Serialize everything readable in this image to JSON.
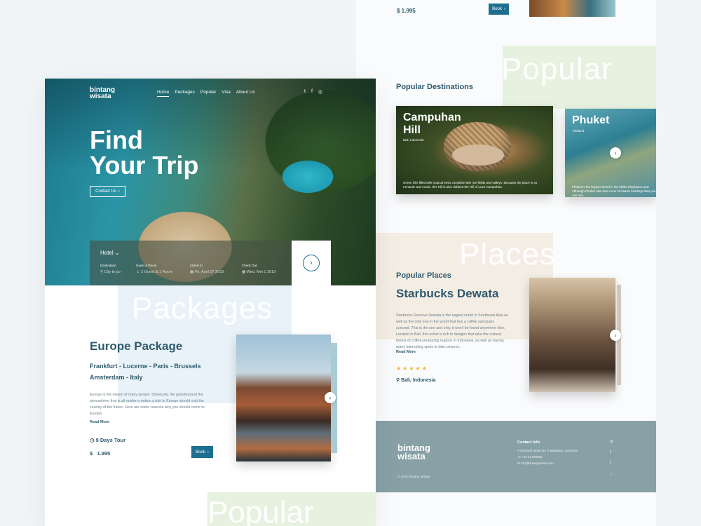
{
  "brand": {
    "logo_line1": "bintang",
    "logo_line2": "wisata",
    "accent_color": "#e2454a",
    "primary_color": "#1e6f8f"
  },
  "top_strip": {
    "price": "$  1.995",
    "book_label": "Book",
    "arrow": "›"
  },
  "nav": {
    "items": [
      {
        "label": "Home",
        "active": true
      },
      {
        "label": "Packages",
        "active": false
      },
      {
        "label": "Popular",
        "active": false
      },
      {
        "label": "Visa",
        "active": false
      },
      {
        "label": "About Us",
        "active": false
      }
    ],
    "social_icons": [
      "twitter-icon",
      "facebook-icon",
      "instagram-icon"
    ],
    "social_glyphs": [
      "t",
      "f",
      "◎"
    ]
  },
  "hero": {
    "title_line1": "Find",
    "title_line2": "Your Trip",
    "cta_label": "Contact Us",
    "cta_arrow": "›"
  },
  "search": {
    "type": "Hotel",
    "type_arrow": "⌄",
    "fields": [
      {
        "label": "Destination",
        "value": "City to go",
        "icon": "location-pin-icon"
      },
      {
        "label": "Guest & Room",
        "value": "2 Guest & 1 Room",
        "icon": "person-icon"
      },
      {
        "label": "Check In",
        "value": "Fri, April 27 2019",
        "icon": "calendar-icon"
      },
      {
        "label": "Check Out",
        "value": "Wed, Mei 1 2019",
        "icon": "calendar-icon"
      }
    ],
    "go_arrow": "›"
  },
  "packages": {
    "bg_word": "Packages",
    "title": "Europe Package",
    "route_line1": "Frankfurt - Lucerne - Paris - Brussels",
    "route_line2": "Amsterdam  - Italy",
    "description": "Europe is the dream of many people. Obviously, the grandeurand the atmosphere that is all modern makes a visit to Europe should visit the country of the future. Here are some reasons why you should come to Europe.",
    "read_more": "Read More",
    "duration": "9 Days Tour",
    "price": "1.995",
    "currency": "$",
    "book_label": "Book",
    "arrow": "›"
  },
  "popular_destinations": {
    "bg_word": "Popular",
    "title": "Popular Destinations",
    "cards": [
      {
        "name_line1": "Campuhan",
        "name_line2": "Hill",
        "location": "Bali, Indonesia",
        "description": "Green hills filled with tropical trees complete with rice fields and valleys. Because the place is so romantic and exotic, this Hill is also dubbed the Hill of Love Campuhan."
      },
      {
        "name_line1": "Phuket",
        "name_line2": "",
        "location": "Thailand",
        "description": "Phuket is the largest island in the White Elephant Land. Although Phuket also has a row of classic buildings that you can see."
      }
    ],
    "next_arrow": "›"
  },
  "popular_places": {
    "bg_word": "Places",
    "title": "Popular Places",
    "place_name": "Starbucks Dewata",
    "description": "Starbucks Reserve Dewata is the largest outlet in Southeast Asia as well as the only one in the world that has a coffee sanctuary concept. This is the one and only, it won't be found anywhere else. Located in Bali, this outlet is rich in designs that take the cultural theme of coffee-producing regions in Indonesia, as well as having many interesting spots to take pictures.",
    "read_more": "Read More",
    "rating": 5,
    "stars": "★★★★★",
    "location": "Bali, Indonesia",
    "next_arrow": "›"
  },
  "footer": {
    "copyright": "© 2020 Bintang Wisata",
    "contact_title": "Contact Info",
    "address": "Bulevard Street No. 3 Makassar, Indonesia",
    "phone": "+62 21 000000",
    "email": "info@bintangwisata.com",
    "social_icons": [
      "instagram-icon",
      "twitter-icon",
      "facebook-icon",
      "dribbble-icon"
    ],
    "social_glyphs": [
      "◎",
      "t",
      "f",
      "◌"
    ]
  },
  "bottom": {
    "bg_word": "Popular"
  }
}
